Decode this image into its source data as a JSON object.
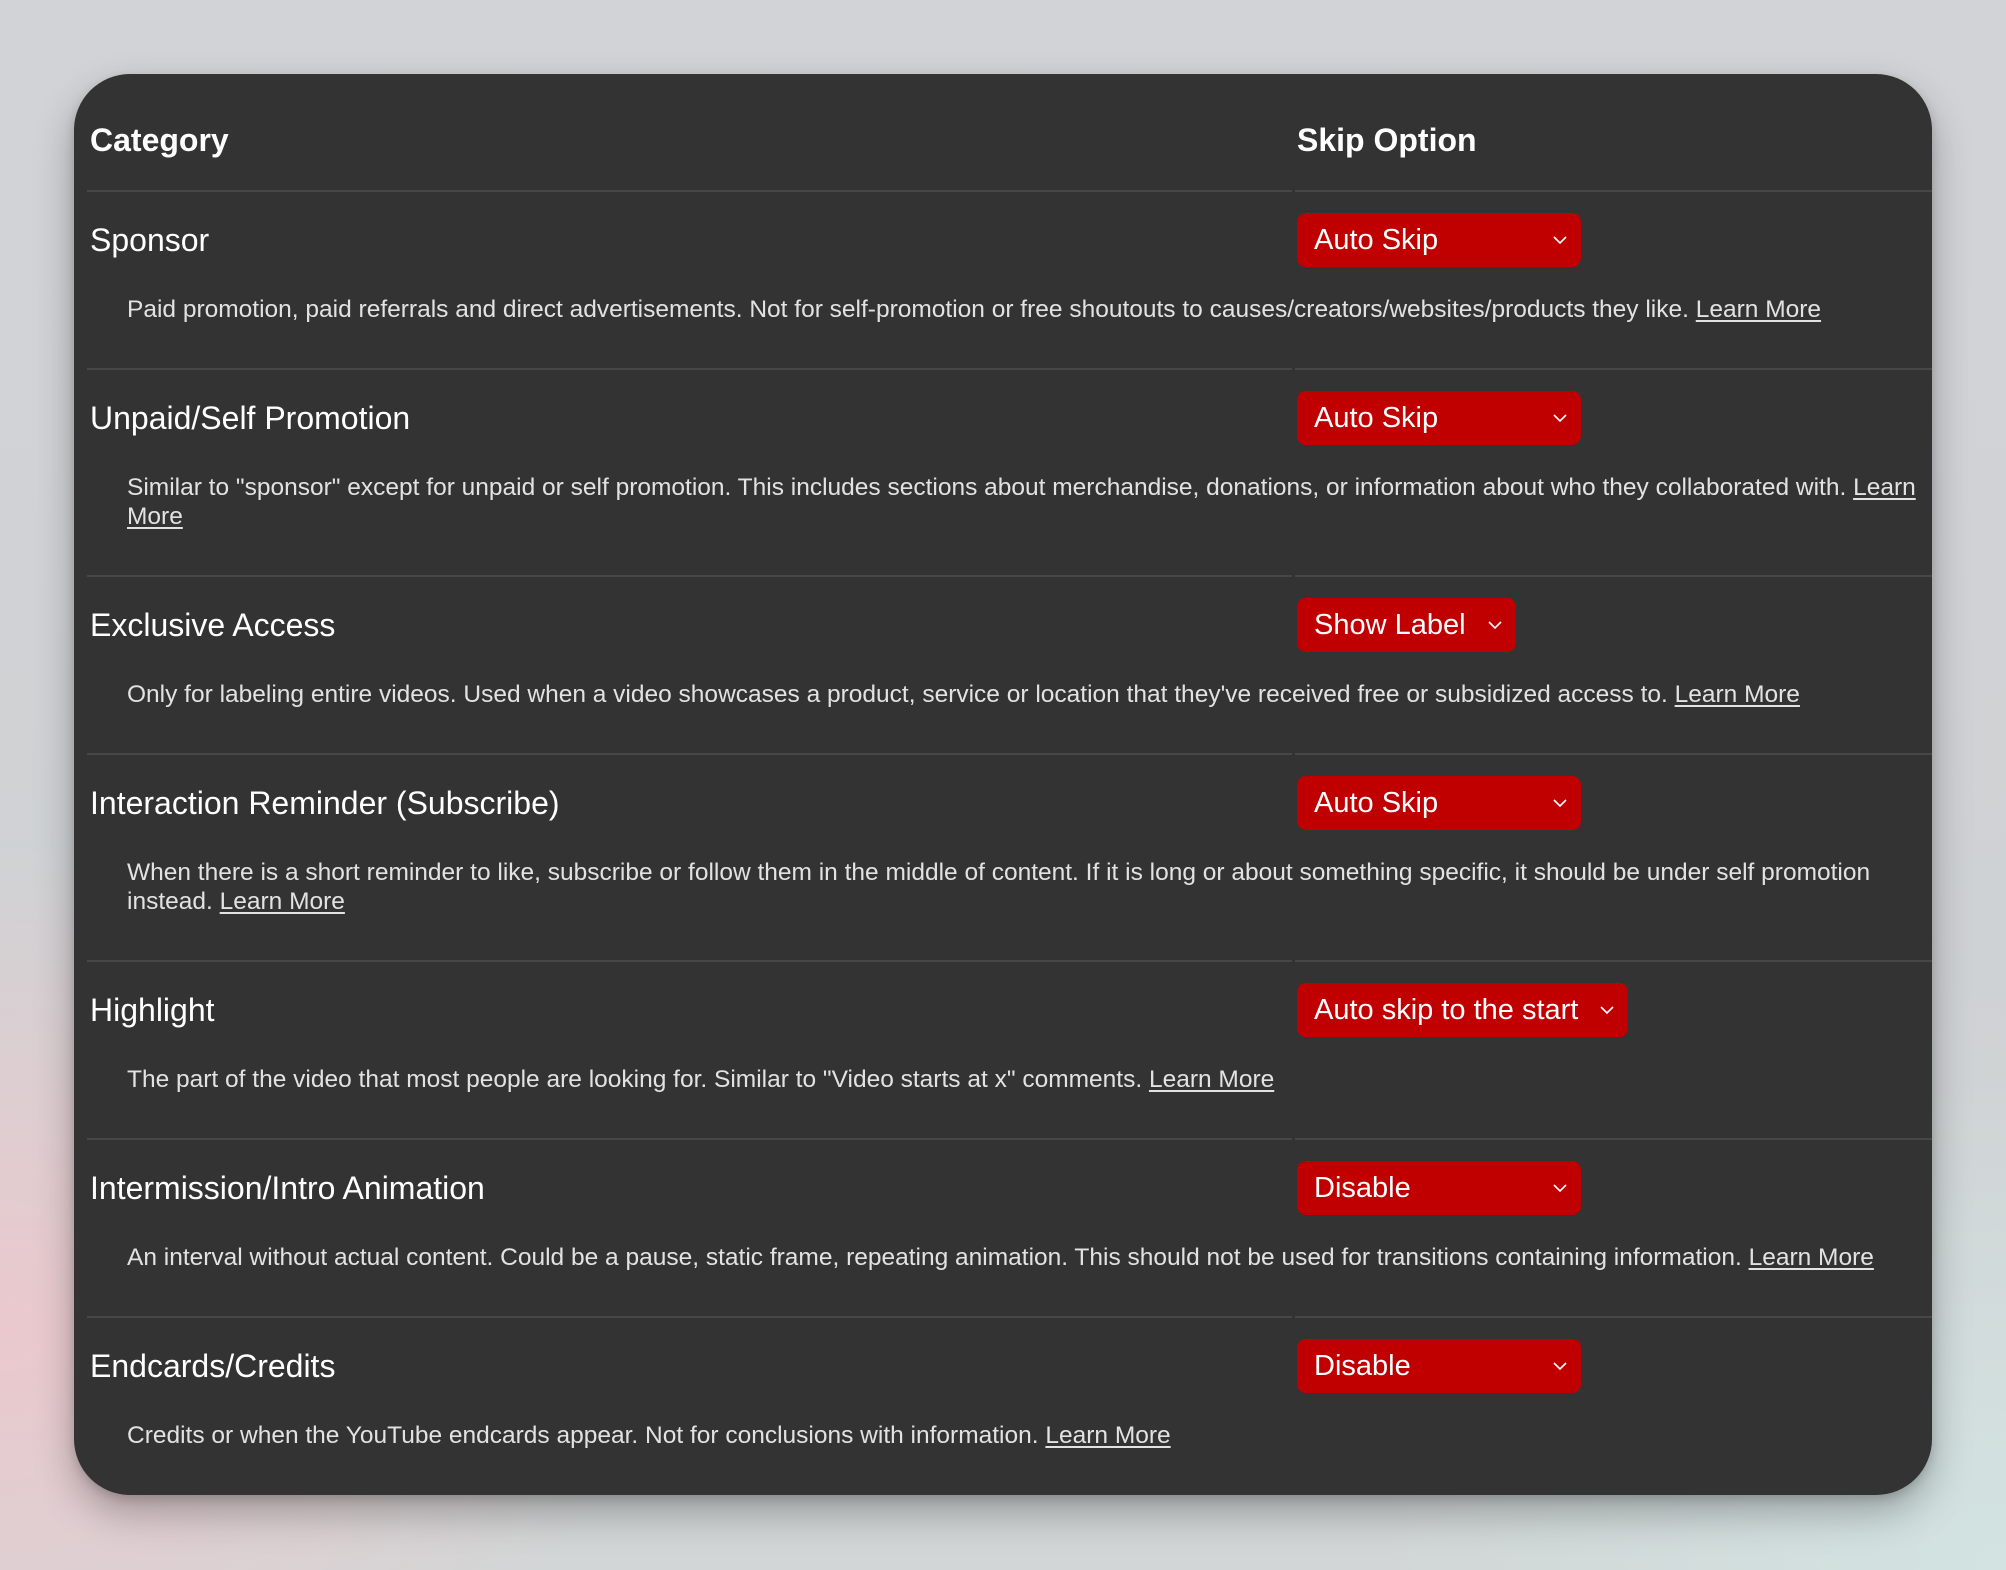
{
  "table": {
    "headers": {
      "category": "Category",
      "skip_option": "Skip Option"
    },
    "learn_more_label": "Learn More",
    "rows": [
      {
        "category": "Sponsor",
        "option": "Auto Skip",
        "description": "Paid promotion, paid referrals and direct advertisements. Not for self-promotion or free shoutouts to causes/creators/websites/products they like."
      },
      {
        "category": "Unpaid/Self Promotion",
        "option": "Auto Skip",
        "description": "Similar to \"sponsor\" except for unpaid or self promotion. This includes sections about merchandise, donations, or information about who they collaborated with."
      },
      {
        "category": "Exclusive Access",
        "option": "Show Label",
        "description": "Only for labeling entire videos. Used when a video showcases a product, service or location that they've received free or subsidized access to."
      },
      {
        "category": "Interaction Reminder (Subscribe)",
        "option": "Auto Skip",
        "description": "When there is a short reminder to like, subscribe or follow them in the middle of content. If it is long or about something specific, it should be under self promotion instead."
      },
      {
        "category": "Highlight",
        "option": "Auto skip to the start",
        "description": "The part of the video that most people are looking for. Similar to \"Video starts at x\" comments."
      },
      {
        "category": "Intermission/Intro Animation",
        "option": "Disable",
        "description": "An interval without actual content. Could be a pause, static frame, repeating animation. This should not be used for transitions containing information."
      },
      {
        "category": "Endcards/Credits",
        "option": "Disable",
        "description": "Credits or when the YouTube endcards appear. Not for conclusions with information."
      }
    ]
  },
  "colors": {
    "card_background": "#333333",
    "select_background": "#c00000",
    "separator": "#474747",
    "text_primary": "#ffffff",
    "text_secondary": "#e2e2e2"
  }
}
